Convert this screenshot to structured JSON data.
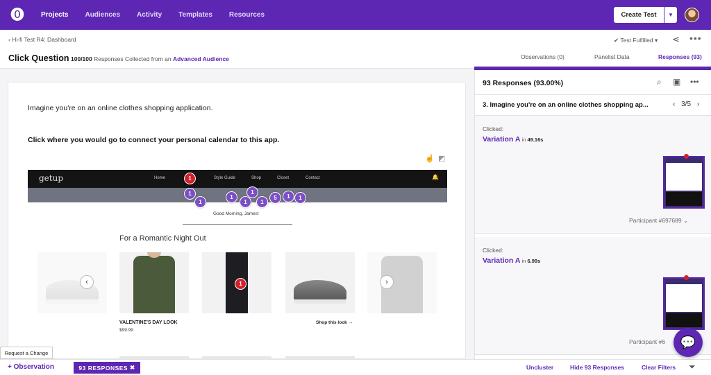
{
  "nav": {
    "items": [
      "Projects",
      "Audiences",
      "Activity",
      "Templates",
      "Resources"
    ],
    "create_test": "Create Test"
  },
  "header": {
    "breadcrumb": "Hi-fi Test R4: Dashboard",
    "title": "Click Question",
    "responses_count": "100",
    "responses_total": "/100",
    "responses_text": " Responses Collected from an ",
    "audience_link": "Advanced Audience",
    "status": "Test Fulfilled",
    "tabs": [
      "Observations (0)",
      "Panelist Data",
      "Responses (93)"
    ]
  },
  "question": {
    "prompt": "Imagine you're on an online clothes shopping application.",
    "task": "Click where you would go to connect your personal calendar to this app."
  },
  "app_preview": {
    "logo": "getup",
    "nav": [
      "Home",
      "Style Guide",
      "Shop",
      "Closet",
      "Contact"
    ],
    "greeting": "Good Morning, James!",
    "section_title": "For a Romantic Night Out",
    "product_title": "VALENTINE'S DAY LOOK",
    "product_price": "$99.99",
    "shop_link": "Shop this look",
    "pins": [
      "1",
      "1",
      "1",
      "1",
      "1",
      "1",
      "1",
      "5",
      "1",
      "1",
      "1"
    ]
  },
  "panel": {
    "count": "93 Responses (93.00%)",
    "question": "3. Imagine you're on an online clothes shopping ap...",
    "pager": "3/5",
    "responses": [
      {
        "clicked": "Clicked:",
        "variation": "Variation A",
        "in": " in ",
        "time": "49.16s",
        "participant": "Participant #697689"
      },
      {
        "clicked": "Clicked:",
        "variation": "Variation A",
        "in": " in ",
        "time": "6.99s",
        "participant": "Participant #6"
      }
    ]
  },
  "bottom": {
    "observation": "+ Observation",
    "badge": "93 RESPONSES",
    "uncluster": "Uncluster",
    "hide": "Hide 93 Responses",
    "clear": "Clear Filters",
    "request_change": "Request a Change"
  }
}
